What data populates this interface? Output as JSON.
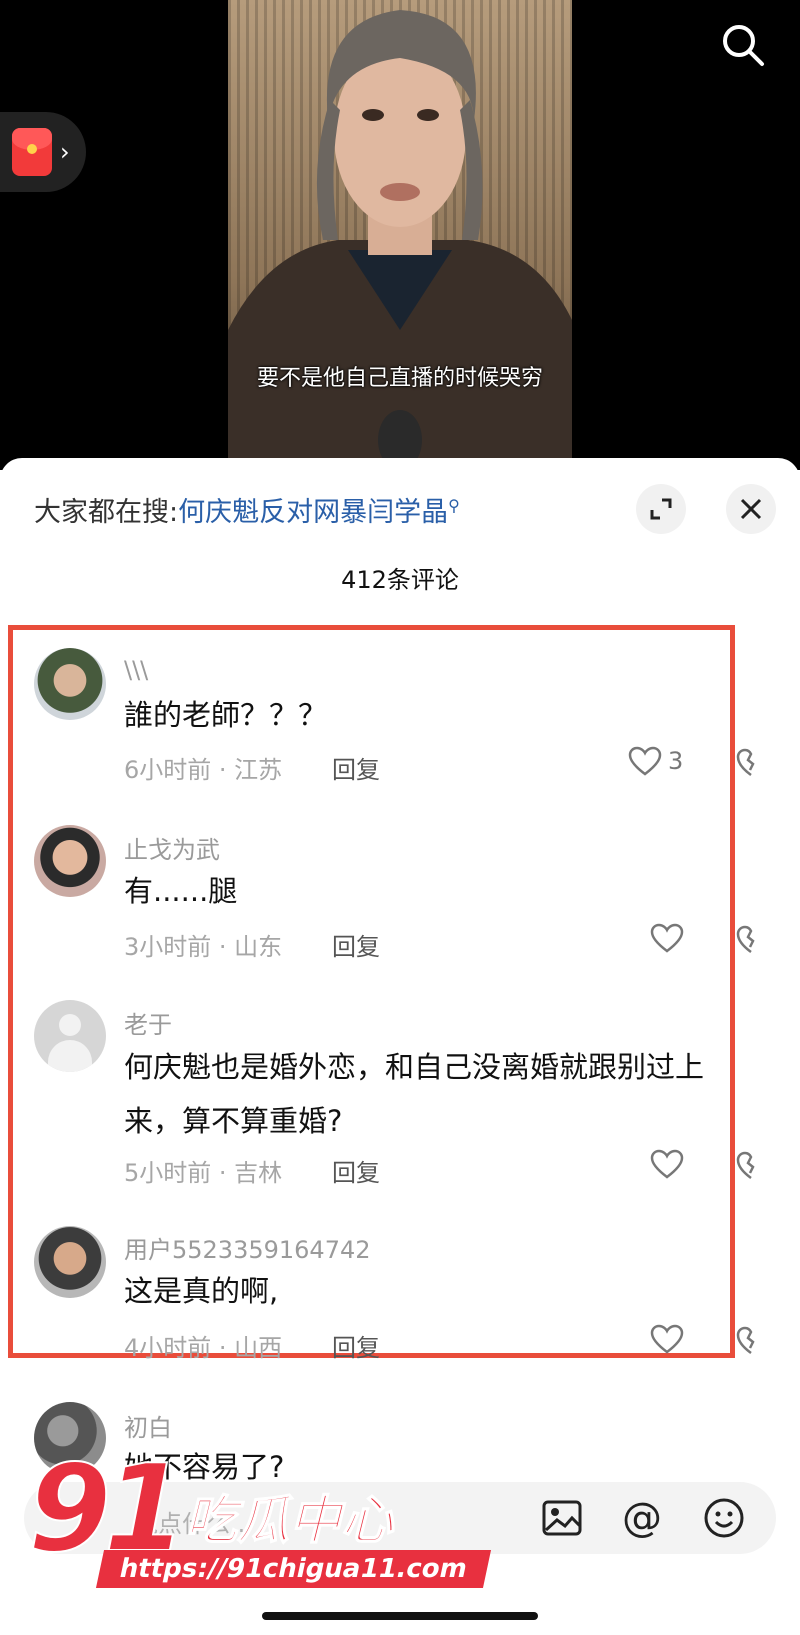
{
  "video": {
    "subtitle": "要不是他自己直播的时候哭穷"
  },
  "sheet": {
    "trending_prefix": "大家都在搜:",
    "trending_query": "何庆魁反对网暴闫学晶",
    "comment_count": "412条评论"
  },
  "comments": [
    {
      "user": "\\\\\\",
      "text": "誰的老師？？？",
      "time_location": "6小时前 · 江苏",
      "reply": "回复",
      "likes": "3"
    },
    {
      "user": "止戈为武",
      "text": "有......腿",
      "time_location": "3小时前 · 山东",
      "reply": "回复",
      "likes": ""
    },
    {
      "user": "老于",
      "text": "何庆魁也是婚外恋，和自己没离婚就跟别过上来，算不算重婚?",
      "time_location": "5小时前 · 吉林",
      "reply": "回复",
      "likes": ""
    },
    {
      "user": "用户5523359164742",
      "text": "这是真的啊,",
      "time_location": "4小时前 · 山西",
      "reply": "回复",
      "likes": ""
    },
    {
      "user": "初白",
      "text": "她不容易了?",
      "time_location": "",
      "reply": "",
      "likes": ""
    }
  ],
  "input": {
    "placeholder": "说点什么..."
  },
  "watermark": {
    "number": "91",
    "name": "吃瓜中心",
    "url": "https://91chigua11.com"
  },
  "colors": {
    "accent_link": "#2a5fa8",
    "highlight_border": "#e94d3b",
    "watermark_red": "#e8303f"
  }
}
